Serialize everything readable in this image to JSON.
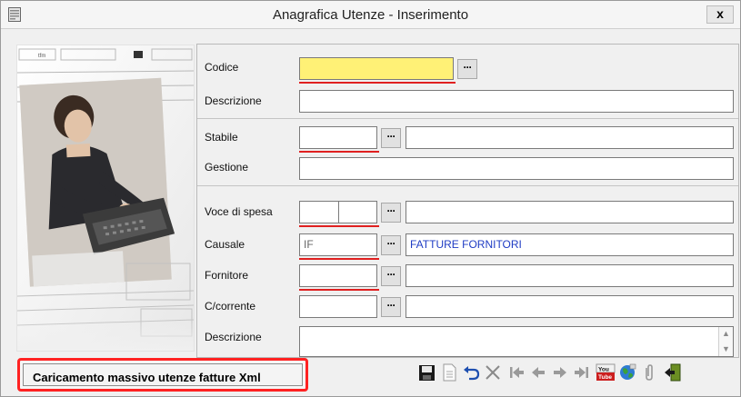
{
  "window": {
    "title": "Anagrafica Utenze - Inserimento",
    "close_label": "x"
  },
  "fields": {
    "codice": {
      "label": "Codice",
      "value": ""
    },
    "descrizione": {
      "label": "Descrizione",
      "value": ""
    },
    "stabile": {
      "label": "Stabile",
      "code": "",
      "name": ""
    },
    "gestione": {
      "label": "Gestione",
      "value": ""
    },
    "voce_di_spesa": {
      "label": "Voce di spesa",
      "code1": "",
      "code2": "",
      "name": ""
    },
    "causale": {
      "label": "Causale",
      "code": "IF",
      "name": "FATTURE FORNITORI"
    },
    "fornitore": {
      "label": "Fornitore",
      "code": "",
      "name": ""
    },
    "c_corrente": {
      "label": "C/corrente",
      "code": "",
      "name": ""
    },
    "descrizione2": {
      "label": "Descrizione",
      "value": ""
    }
  },
  "lookup_label": "···",
  "bulk_button": {
    "label": "Caricamento massivo utenze fatture Xml"
  },
  "colors": {
    "required_line": "#e02020",
    "highlight_field": "#fff176",
    "bulk_border": "#ff2222"
  },
  "toolbar_icons": [
    "save-icon",
    "print-preview-icon",
    "undo-icon",
    "delete-icon",
    "first-icon",
    "previous-icon",
    "next-icon",
    "last-icon",
    "youtube-icon",
    "globe-icon",
    "attachment-icon",
    "exit-icon"
  ]
}
